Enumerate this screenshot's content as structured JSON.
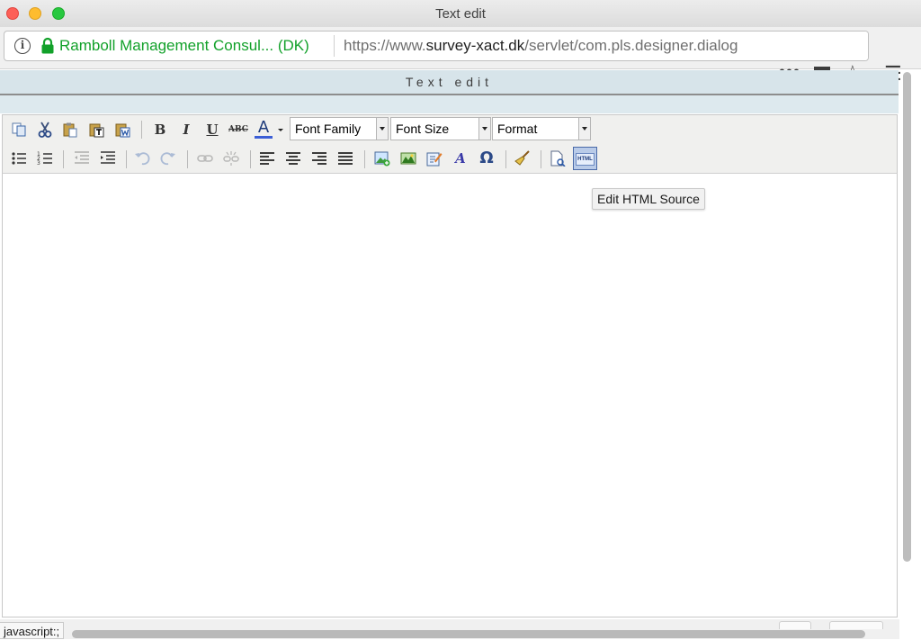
{
  "window": {
    "title": "Text edit"
  },
  "urlbar": {
    "site_identity": "Ramboll Management Consul... (DK)",
    "url_prefix": "https://www.",
    "url_domain": "survey-xact.dk",
    "url_path": "/servlet/com.pls.designer.dialog"
  },
  "dialog": {
    "title": "Text edit"
  },
  "toolbar": {
    "font_family": {
      "selected": "Font Family"
    },
    "font_size": {
      "selected": "Font Size"
    },
    "format": {
      "selected": "Format"
    },
    "bold_label": "B",
    "italic_label": "I",
    "underline_label": "U",
    "strike_label": "ABC",
    "forecolor_label": "A",
    "charmap_label": "Ω",
    "html_label": "HTML",
    "forecolor_accent": "#3b5ed6"
  },
  "tooltip": {
    "text": "Edit HTML Source"
  },
  "status_bar": {
    "text": "javascript:;"
  },
  "colors": {
    "site_identity": "#12a12a",
    "dialog_header_bg": "#d7e4ea",
    "toolbar_bg": "#f0f0ee",
    "html_button_active": "#7e9fd6"
  }
}
